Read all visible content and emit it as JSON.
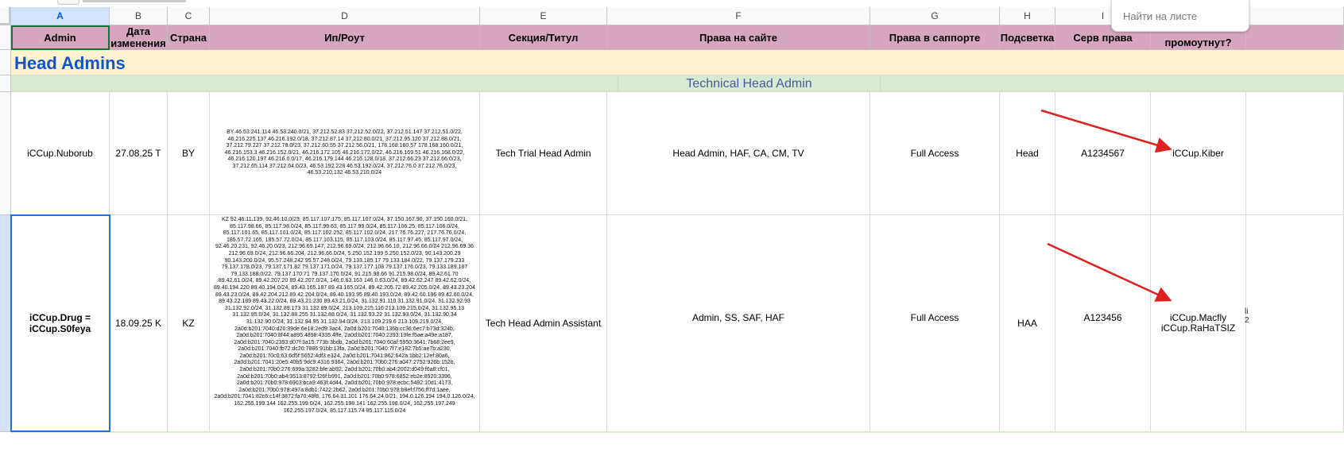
{
  "search": {
    "placeholder": "Найти на листе"
  },
  "columns": [
    "A",
    "B",
    "C",
    "D",
    "E",
    "F",
    "G",
    "H",
    "I"
  ],
  "header_row": {
    "admin": "Admin",
    "date": "Дата изменения",
    "country": "Страна",
    "ip": "Ип/Роут",
    "section": "Секция/Титул",
    "site_rights": "Права на сайте",
    "support_rights": "Права в саппорте",
    "highlight": "Подсветка",
    "serv_rights": "Серв права",
    "promote": "промоутнут?"
  },
  "group_title": "Head Admins",
  "subgroup_title": "Technical Head Admin",
  "rows": [
    {
      "admin": "iCCup.Nuborub",
      "date": "27.08.25 T",
      "country": "BY",
      "ip": "BY 46.53.241.114 46.53.240.0/21, 37.212.52.83 37.212.52.0/22, 37.212.51.147 37.212.51.0/22, 46.216.225.137 46.216.192.0/18, 37.212.87.14 37.212.80.0/21, 37.212.95.120 37.212.88.0/21, 37.212.79.227 37.212.78.0/23, 37.212.60.55 37.212.56.0/21, 178.168.160.57 178.168.160.0/21, 46.216.153.3 46.216.152.0/21, 46.216.172.105 46.216.172.0/22, 46.216.169.51 46.216.168.0/22, 46.216.120.197 46.216.0.0/17, 46.216.179.144 46.216.128.0/18, 37.212.66.23 37.212.66.0/23, 37.212.65.114 37.212.64.0/23, 46.53.192.228 46.53.192.0/24, 37.212.76.0 37.212.76.0/23, 46.53.210.132 46.53.210.0/24",
      "section": "Tech Trial Head Admin",
      "site_rights": "Head Admin, HAF, CA, CM, TV",
      "support_rights": "Full Access",
      "highlight": "Head",
      "serv_rights": "A1234567",
      "promote": "iCCup.Kiber"
    },
    {
      "admin": "iCCup.Drug = iCCup.S0feya",
      "date": "18.09.25 K",
      "country": "KZ",
      "ip": "KZ 92.46.11.139, 92.46.10.0/23, 85.117.107.175, 85.117.107.0/24, 37.150.167.90, 37.150.160.0/21, 85.117.98.66, 85.117.98.0/24, 85.117.99.63, 85.117.99.0/24, 85.117.106.25, 85.117.106.0/24, 85.117.101.65, 85.117.101.0/24, 85.117.102.252, 85.117.102.0/24, 217.76.76.227, 217.76.76.0/24, 185.57.72.165, 185.57.72.0/24, 85.117.103.115, 85.117.103.0/24, 85.117.97.45, 85.117.97.0/24, 92.46.20.231, 92.46.20.0/23, 212.96.69.147, 212.96.69.0/24, 212.96.66.10, 212.96.66.0/24 212.96.69.36 212.96.69.0/24, 212.96.66.204, 212.96.66.0/24, 5.250.152.199 5.250.152.0/23, 90.143.200.29 90.143.200.0/24, 95.57.248.242 95.57.248.0/24, 79.133.185.17 79.133.184.0/22, 79.137.179.233 79.137.178.0/23, 79.137.171.82 79.137.171.0/24, 79.137.177.108 79.137.176.0/23, 79.133.189.187 79.133.188.0/22, 79.137.170.71 79.137.170.0/24, 91.215.98.66 91.215.98.0/24, 89.42.61.70 89.42.61.0/24, 89.42.207.20 89.42.207.0/24, 146.0.63.163 146.0.63.0/24, 89.42.62.247 89.42.62.0/24, 89.40.194.220 89.40.194.0/24, 89.43.165.187 89.43.165.0/24, 89.42.205.72 89.42.205.0/24, 89.43.23.204 89.43.23.0/24, 89.42.204.212 89.42.204.0/24, 89.40.193.95 89.40.193.0/24, 89.42.60.196 89.42.60.0/24, 89.43.22.189 89.43.22.0/24, 89.43.21.230 89.43.21.0/24, 31.132.91.110 31.132.91.0/24, 31.132.92.93 31.132.92.0/24, 31.132.89.173 31.132.89.0/24, 213.109.215.116 213.109.215.0/24, 31.132.95.13 31.132.95.0/24, 31.132.88.255 31.132.88.0/24, 31.132.93.22 31.132.93.0/24, 31.132.90.34 31.132.90.0/24, 31.132.94.95 31.132.94.0/24, 213.109.219.6 213.109.219.0/24, 2a0d:b201:7040:d20:39de:6e18:2ed9:3ac4, 2a0d:b201:7040:136b:cc36:6ec7:b73d:324b, 2a0d:b201:7040:8f44:a895:4898:4335:4ffe, 2a0d:b201:7040:2393:19fe:f5ae:a49e:a187, 2a0d:b201:7040:2393:d07f:3a15:773b:3bdb, 2a0d:b201:7040:60af:5950:3641:7b68:2ee9, 2a0d:b201:7040:fb72:dc20:7886:91bb:13fa, 2a0d:b201:7040:7f7:e182:7b5:ae7b:a230, 2a0d:b201:70c0:63:6d5f:5652:4df3:e324, 2a0d:b201:7041:862:642a:1bb2:12ef:80a6, 2a0d:b201:7041:20e5:40b5:9dc9:4316:9364, 2a0d:b201:70b0:276:a047:2752:926b:152b, 2a0d:b201:70b0:276:699a:3282:bfe:ab92, 2a0d:b201:70b0:ab4:2002:d049:f6a8:cf01, 2a0d:b201:70b0:ab4:3513:8792:f26f:b991, 2a0d:b201:70b0:978:6852:eb2e:8920:3396, 2a0d:b201:70b0:978:6903:bca9:463f:4d44, 2a0d:b201:70b0:978:ecbc:5492:10d1:4173, 2a0d:b201:70b0:978:497a:8db1:7422:2b62, 2a0d:b201:70b0:978:b8ef:f756:ff7d:1aee, 2a0d:b201:7041:82c6:c14f:3872:fa70:48f8, 176.64.31.101 176.64.24.0/21, 194.0.126.194 194.0.126.0/24, 162.255.199.144 162.255.199.0/24, 162.255.198.141 162.255.198.0/24, 162.255.197.249 162.255.197.0/24, 85.117.115.74 85.117.115.0/24",
      "section": "Tech Head Admin Assistant",
      "site_rights": "Admin, SS, SAF, HAF",
      "support_rights": "Full Access",
      "highlight": "HAA",
      "serv_rights": "A123456",
      "promote_1": "iCCup.Macfly",
      "promote_2": "iCCup.RaHaTSIZ"
    }
  ],
  "edge_text": "li\n2",
  "colors": {
    "header_bg": "#d5a6bd",
    "group_bg": "#fff2cc",
    "group_text": "#1155cc",
    "subgroup_bg": "#d9ead3",
    "subgroup_text": "#4a5b9c",
    "selection": "#1a73e8",
    "arrow": "#e02020"
  },
  "icons": [
    "red-arrow-annotation"
  ]
}
